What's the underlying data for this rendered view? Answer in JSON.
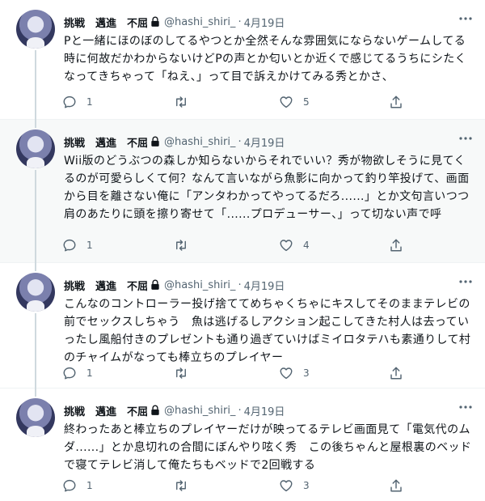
{
  "author": {
    "display_name": "挑戦　邁進　不屈",
    "handle": "@hashi_shiri_",
    "separator": "·"
  },
  "colors": {
    "text": "#0f1419",
    "muted": "#536471",
    "divider": "#eff3f4",
    "highlight_bg": "#f7f9f9",
    "thread_line": "#cfd9de"
  },
  "icons": [
    "lock-icon",
    "more-icon",
    "reply-icon",
    "retweet-icon",
    "like-icon",
    "share-icon"
  ],
  "tweets": [
    {
      "date": "4月19日",
      "text": "Pと一緒にほのぼのしてるやつとか全然そんな雰囲気にならないゲームしてる時に何故だかわからないけどPの声とか匂いとか近くで感じてるうちにシたくなってきちゃって「ねえ、」って目で訴えかけてみる秀とかさ、",
      "replies": "1",
      "retweets": "",
      "likes": "5"
    },
    {
      "date": "4月19日",
      "text": "Wii版のどうぶつの森しか知らないからそれでいい？秀が物欲しそうに見てくるのが可愛らしくて何？なんて言いながら魚影に向かって釣り竿投げて、画面から目を離さない俺に「アンタわかってやってるだろ......」とか文句言いつつ肩のあたりに頭を擦り寄せて「......プロデューサー、」って切ない声で呼",
      "replies": "1",
      "retweets": "",
      "likes": "4"
    },
    {
      "date": "4月19日",
      "text": "こんなのコントローラー投げ捨ててめちゃくちゃにキスしてそのままテレビの前でセックスしちゃう　魚は逃げるしアクション起こしてきた村人は去っていったし風船付きのプレゼントも通り過ぎていけばミイロタテハも素通りして村のチャイムがなっても棒立ちのプレイヤー",
      "replies": "1",
      "retweets": "",
      "likes": "3"
    },
    {
      "date": "4月19日",
      "text": "終わったあと棒立ちのプレイヤーだけが映ってるテレビ画面見て「電気代のムダ......」とか息切れの合間にぼんやり呟く秀　この後ちゃんと屋根裏のベッドで寝てテレビ消して俺たちもベッドで2回戦する",
      "replies": "1",
      "retweets": "",
      "likes": "3"
    }
  ]
}
